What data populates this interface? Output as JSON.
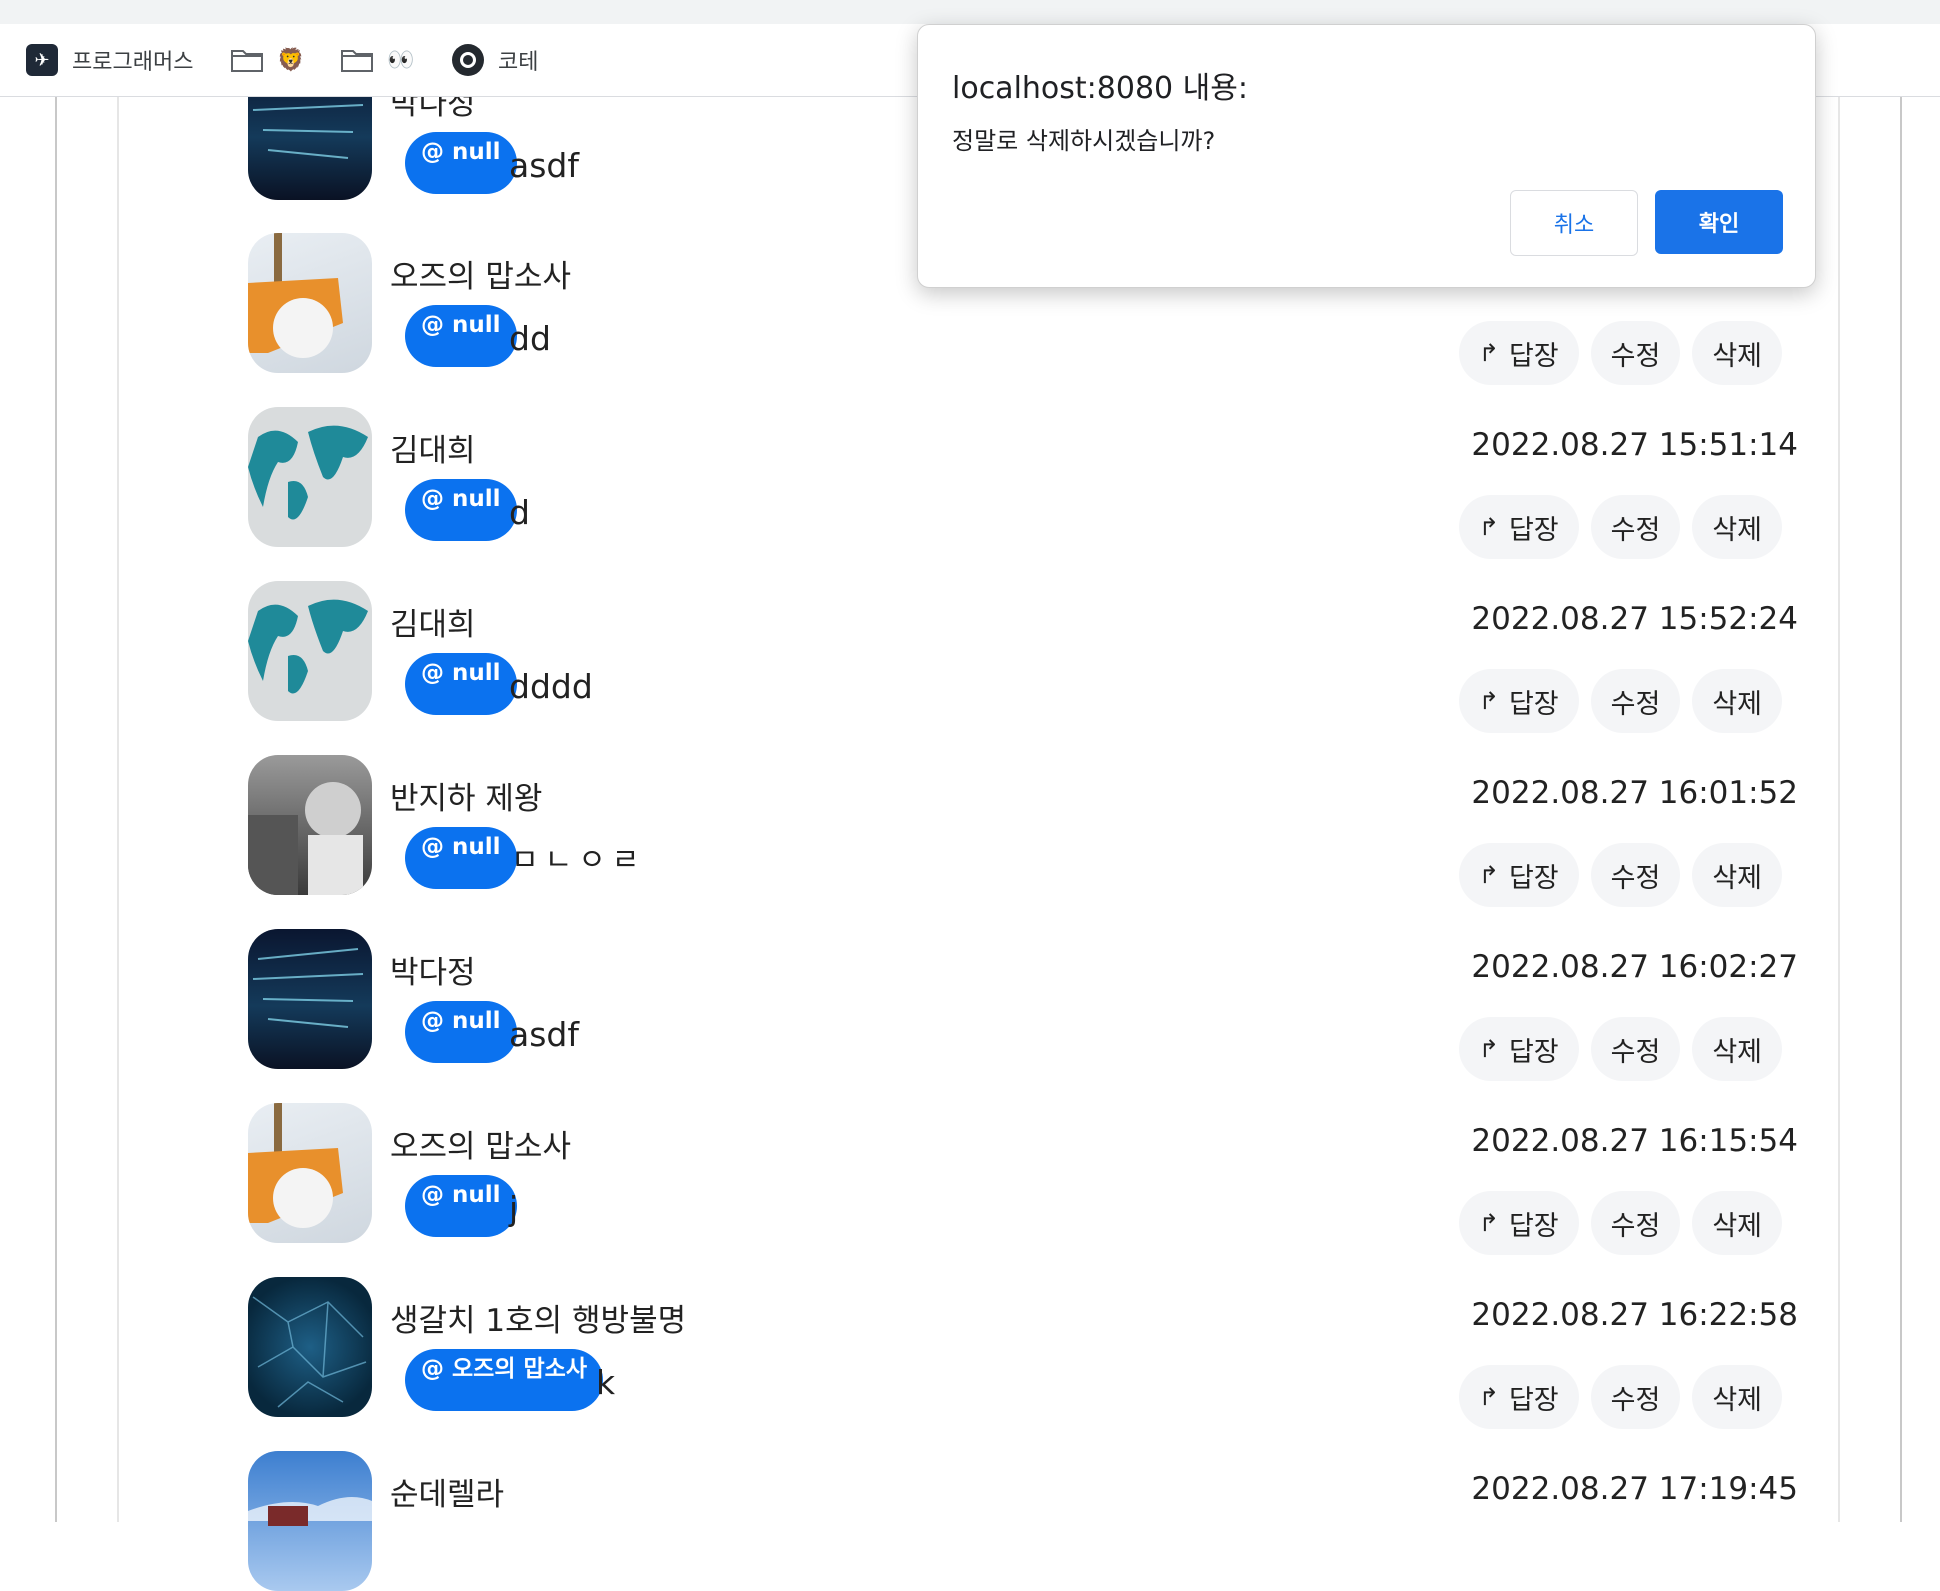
{
  "bookmarks": [
    {
      "label": "프로그래머스",
      "icon": "programmers-logo-icon"
    },
    {
      "label": "🦁",
      "icon": "folder-icon"
    },
    {
      "label": "👀",
      "icon": "folder-icon"
    },
    {
      "label": "코테",
      "icon": "github-icon"
    }
  ],
  "dialog": {
    "title": "localhost:8080 내용:",
    "message": "정말로 삭제하시겠습니까?",
    "cancel_label": "취소",
    "ok_label": "확인"
  },
  "actions": {
    "reply": "답장",
    "reply_arrow": "↱",
    "edit": "수정",
    "delete": "삭제"
  },
  "comments": [
    {
      "nickname": "박다정",
      "mention": "@ null",
      "text": "asdf",
      "date": "",
      "avatar": "code-tunnel"
    },
    {
      "nickname": "오즈의 맙소사",
      "mention": "@ null",
      "text": "dd",
      "date": "",
      "avatar": "snow-shovel"
    },
    {
      "nickname": "김대희",
      "mention": "@ null",
      "text": "d",
      "date": "2022.08.27 15:51:14",
      "avatar": "world-map"
    },
    {
      "nickname": "김대희",
      "mention": "@ null",
      "text": "dddd",
      "date": "2022.08.27 15:52:24",
      "avatar": "world-map"
    },
    {
      "nickname": "반지하 제왕",
      "mention": "@ null",
      "text": "ㅁㄴㅇㄹ",
      "date": "2022.08.27 16:01:52",
      "avatar": "bw-photo"
    },
    {
      "nickname": "박다정",
      "mention": "@ null",
      "text": "asdf",
      "date": "2022.08.27 16:02:27",
      "avatar": "code-tunnel"
    },
    {
      "nickname": "오즈의 맙소사",
      "mention": "@ null",
      "text": "j",
      "date": "2022.08.27 16:15:54",
      "avatar": "snow-shovel"
    },
    {
      "nickname": "생갈치 1호의 행방불명",
      "mention": "@ 오즈의 맙소사",
      "text": "k",
      "date": "2022.08.27 16:22:58",
      "avatar": "network-blue"
    },
    {
      "nickname": "순데렐라",
      "mention": "",
      "text": "",
      "date": "2022.08.27 17:19:45",
      "avatar": "sky"
    }
  ]
}
